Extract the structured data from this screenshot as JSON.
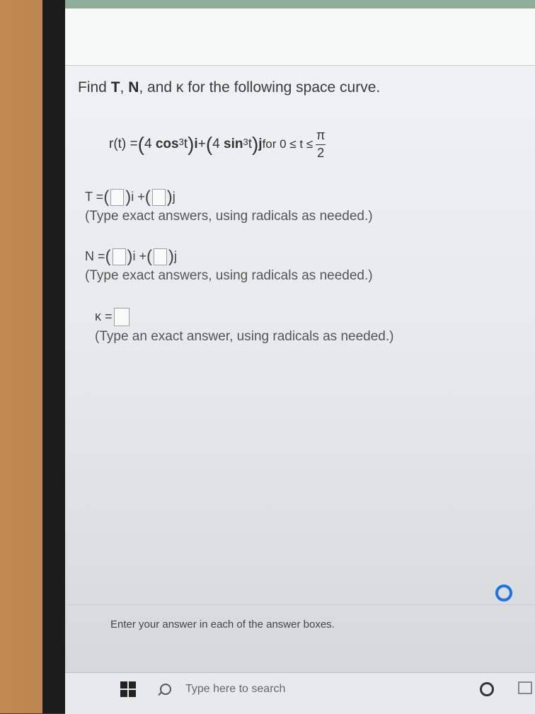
{
  "question": {
    "prompt_pre": "Find ",
    "prompt_T": "T",
    "prompt_sep1": ", ",
    "prompt_N": "N",
    "prompt_mid": ", and ",
    "prompt_kappa": "κ",
    "prompt_post": " for the following space curve."
  },
  "formula": {
    "lhs": "r(t) = ",
    "term1_coef": "4 ",
    "term1_fn": "cos",
    "term1_exp": "3",
    "term1_var": "t",
    "i": "i",
    "plus": " + ",
    "term2_coef": "4 ",
    "term2_fn": "sin",
    "term2_exp": "3",
    "term2_var": "t",
    "j": "j",
    "range": " for 0 ≤ t ≤ ",
    "frac_num": "π",
    "frac_den": "2"
  },
  "answers": {
    "T_label": "T = ",
    "T_i": "i + ",
    "T_j": "j",
    "T_hint": "(Type exact answers, using radicals as needed.)",
    "N_label": "N = ",
    "N_i": "i + ",
    "N_j": "j",
    "N_hint": "(Type exact answers, using radicals as needed.)",
    "K_label": "κ = ",
    "K_hint": "(Type an exact answer, using radicals as needed.)"
  },
  "footer": {
    "enter_message": "Enter your answer in each of the answer boxes."
  },
  "taskbar": {
    "search_placeholder": "Type here to search"
  },
  "colors": {
    "accent": "#1a73e8"
  }
}
